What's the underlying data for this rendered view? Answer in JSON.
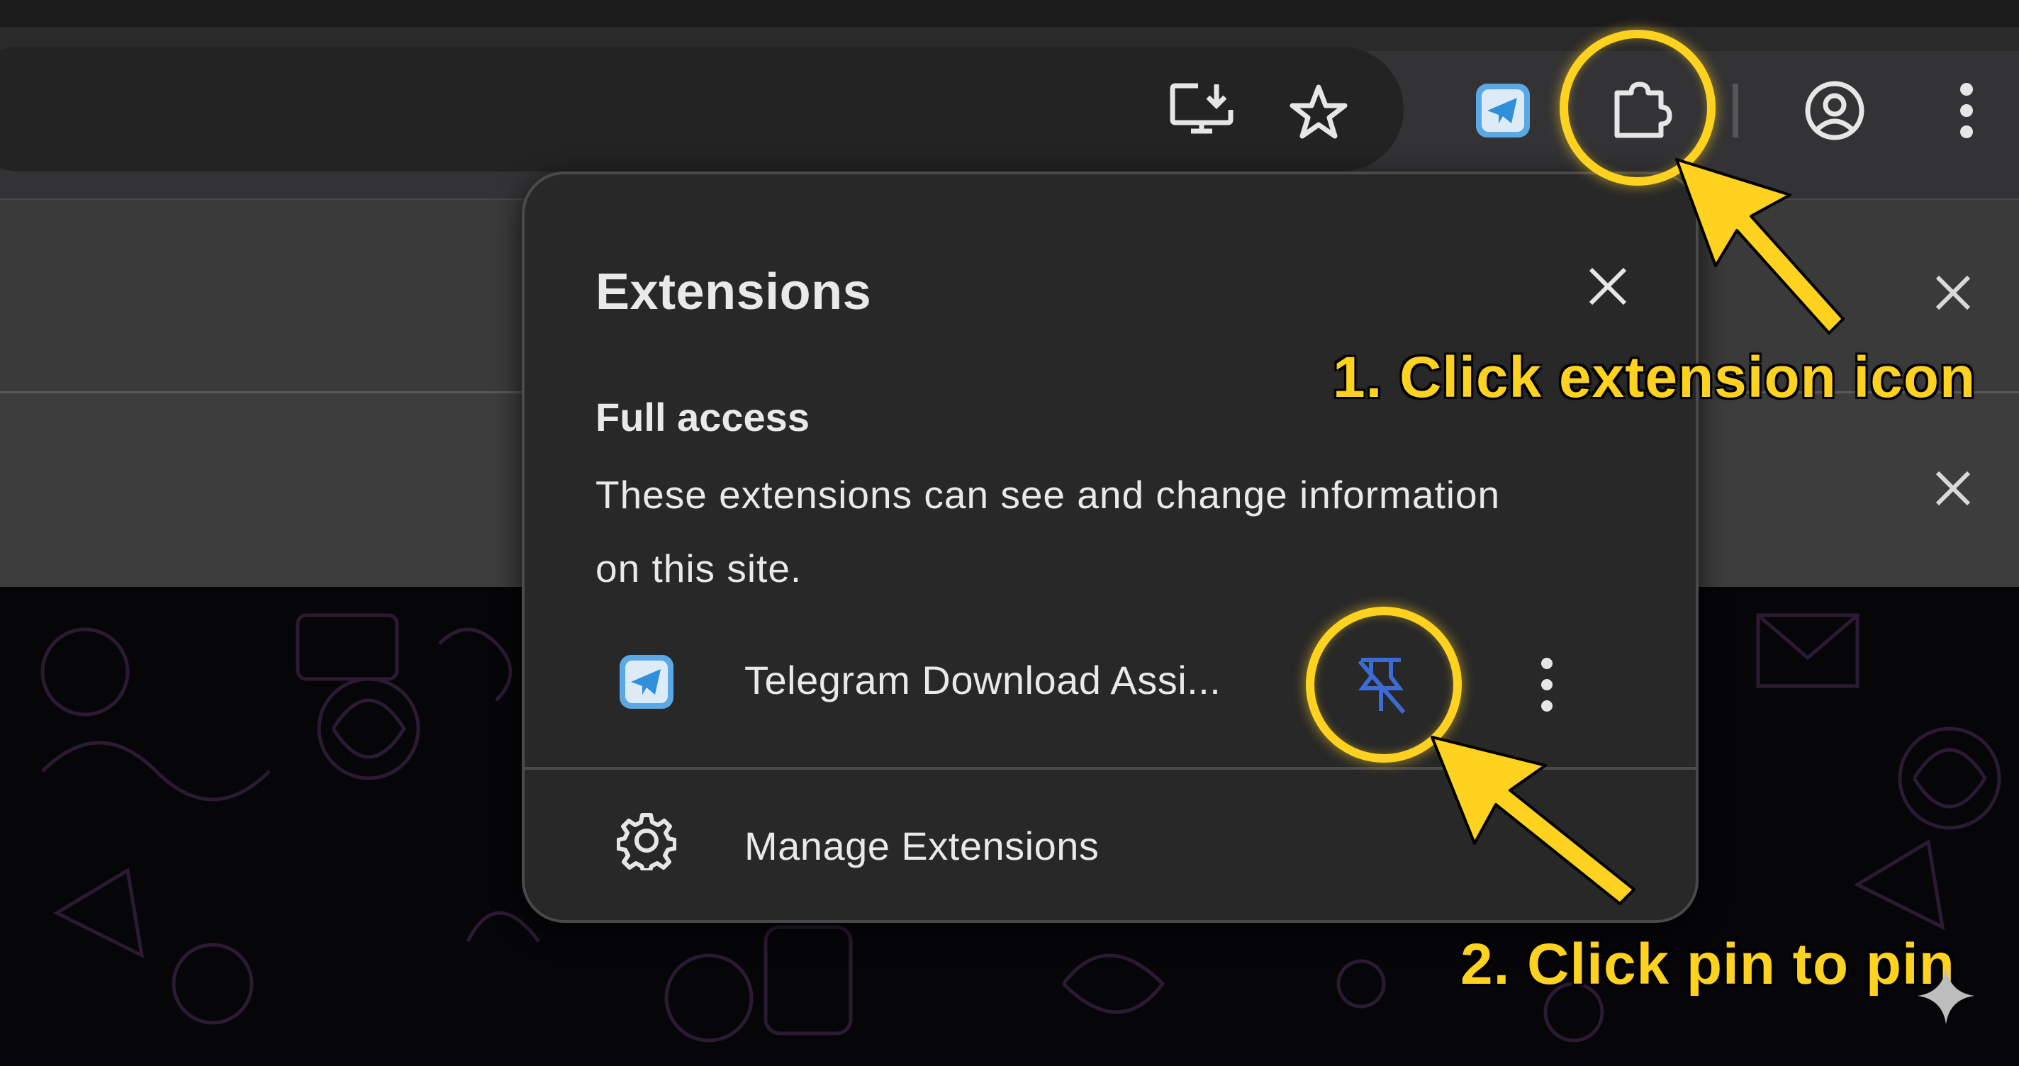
{
  "popup": {
    "title": "Extensions",
    "section_heading": "Full access",
    "section_description": "These extensions can see and change information on this site.",
    "extensions": [
      {
        "name": "Telegram Download Assi...",
        "icon": "telegram-paper-plane-icon",
        "pinned": false
      }
    ],
    "manage_label": "Manage Extensions"
  },
  "toolbar": {
    "icons": [
      "install-app-icon",
      "bookmark-star-icon",
      "telegram-extension-icon",
      "extensions-puzzle-icon",
      "profile-icon",
      "more-menu-icon"
    ]
  },
  "annotations": {
    "step1": "1. Click extension icon",
    "step2": "2. Click pin to pin"
  },
  "colors": {
    "highlight": "#ffd21f",
    "popup_bg": "#282828",
    "toolbar_bg": "#333335",
    "pin_icon": "#3d6bd6"
  }
}
